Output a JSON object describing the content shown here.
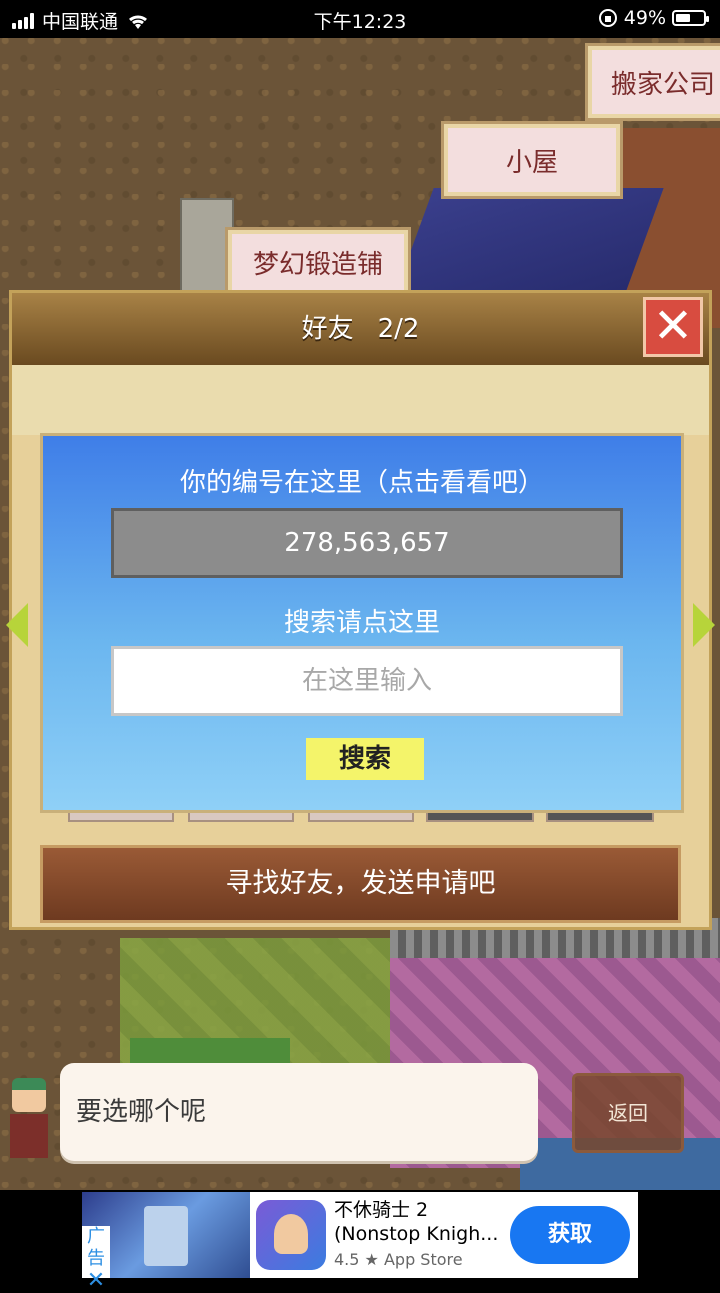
{
  "status_bar": {
    "carrier": "中国联通",
    "time": "下午12:23",
    "battery": "49%",
    "battery_level": 0.49,
    "icons": [
      "signal-icon",
      "wifi-icon",
      "orientation-lock-icon",
      "battery-icon"
    ]
  },
  "map": {
    "signs": [
      "搬家公司",
      "小屋",
      "梦幻锻造铺"
    ]
  },
  "dialog": {
    "title": "好友",
    "page": "2/2",
    "close_icon": "close-icon",
    "panel": {
      "title": "你的编号在这里（点击看看吧）",
      "player_id": "278,563,657",
      "search_label": "搜索请点这里",
      "search_placeholder": "在这里输入",
      "search_button": "搜索"
    },
    "find_friends": "寻找好友，发送申请吧"
  },
  "chat": {
    "bubble_text": "要选哪个呢",
    "back_button": "返回"
  },
  "ad": {
    "tag": "广告",
    "title": "不休骑士 2 (Nonstop Knigh...",
    "rating": "4.5 ★ App Store",
    "cta": "获取"
  },
  "colors": {
    "panel_blue": "#3f7ee8",
    "search_button": "#f4f46a",
    "close_red": "#d84c40",
    "ad_button": "#1877f2"
  }
}
